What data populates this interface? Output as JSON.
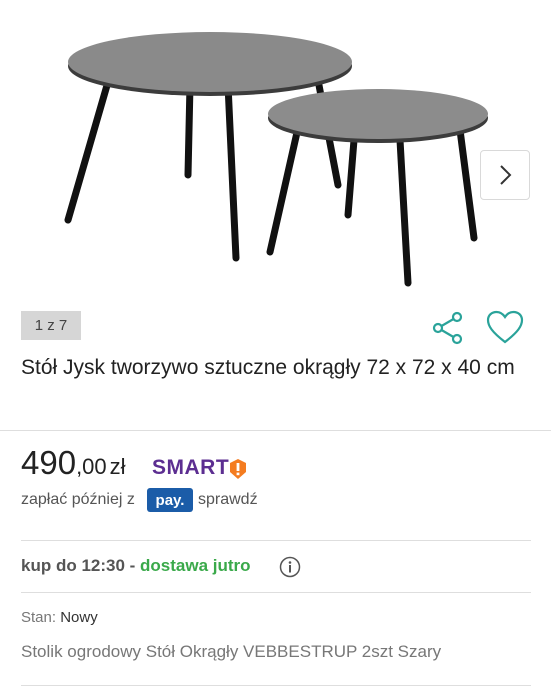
{
  "gallery": {
    "counter": "1 z 7",
    "image": "round-nesting-tables-photo",
    "next_icon": "chevron-right-icon"
  },
  "actions": {
    "share_icon": "share-icon",
    "favorite_icon": "heart-icon"
  },
  "product": {
    "title": "Stół Jysk tworzywo sztuczne okrągły 72 x 72 x 40 cm",
    "price_int": "490",
    "price_rest": ",00",
    "currency": "zł",
    "smart_label": "SMART",
    "smart_color": "#5c2e91",
    "smart_badge_color": "#f47c20"
  },
  "payment": {
    "text": "zapłać później z",
    "logo": "pay.",
    "logo_color": "#1b5ca8",
    "link": "sprawdź"
  },
  "delivery": {
    "prefix": "kup do 12:30 - ",
    "highlight": "dostawa jutro",
    "highlight_color": "#3aa94a",
    "info_icon": "info-icon"
  },
  "details": {
    "condition_label": "Stan:",
    "condition_value": "Nowy",
    "subtitle": "Stolik ogrodowy Stół Okrągły VEBBESTRUP 2szt Szary"
  }
}
